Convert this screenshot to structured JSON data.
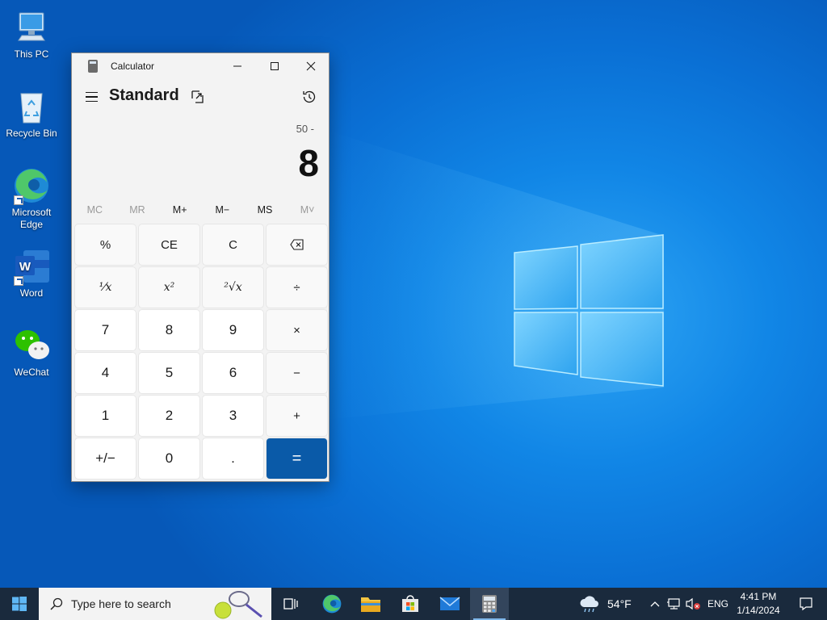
{
  "desktop": {
    "icons": [
      {
        "label": "This PC"
      },
      {
        "label": "Recycle Bin"
      },
      {
        "label": "Microsoft Edge"
      },
      {
        "label": "Word"
      },
      {
        "label": "WeChat"
      }
    ]
  },
  "window": {
    "title": "Calculator",
    "mode": "Standard",
    "expression": "50 -",
    "result": "8"
  },
  "memory": [
    "MC",
    "MR",
    "M+",
    "M−",
    "MS",
    "M˅"
  ],
  "keys": {
    "percent": "%",
    "ce": "CE",
    "c": "C",
    "reciprocal": "⅟x",
    "square": "x²",
    "sqrt": "²√x",
    "divide": "÷",
    "seven": "7",
    "eight": "8",
    "nine": "9",
    "multiply": "×",
    "four": "4",
    "five": "5",
    "six": "6",
    "minus": "−",
    "one": "1",
    "two": "2",
    "three": "3",
    "plus": "+",
    "negate": "+/−",
    "zero": "0",
    "decimal": ".",
    "equals": "="
  },
  "taskbar": {
    "search_placeholder": "Type here to search",
    "weather": "54°F",
    "language": "ENG",
    "time": "4:41 PM",
    "date": "1/14/2024"
  },
  "colors": {
    "accent": "#0a5aa8",
    "taskbar": "#1a2a3d",
    "wallpaper": "#0a6fd4"
  }
}
